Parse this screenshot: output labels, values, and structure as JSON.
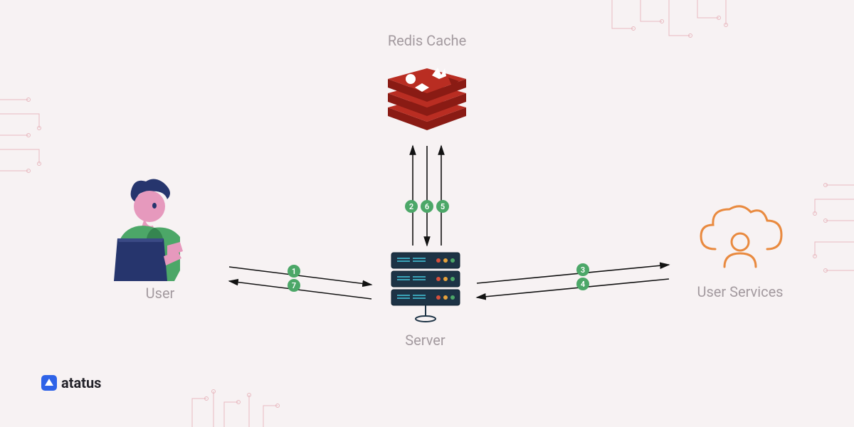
{
  "nodes": {
    "redis": {
      "label": "Redis Cache"
    },
    "user": {
      "label": "User"
    },
    "server": {
      "label": "Server"
    },
    "user_services": {
      "label": "User Services"
    }
  },
  "edges": {
    "user_server_top": "1",
    "user_server_bottom": "7",
    "server_redis_left": "2",
    "server_redis_mid": "6",
    "server_redis_right": "5",
    "server_services_top": "3",
    "server_services_bottom": "4"
  },
  "branding": {
    "name": "atatus"
  }
}
